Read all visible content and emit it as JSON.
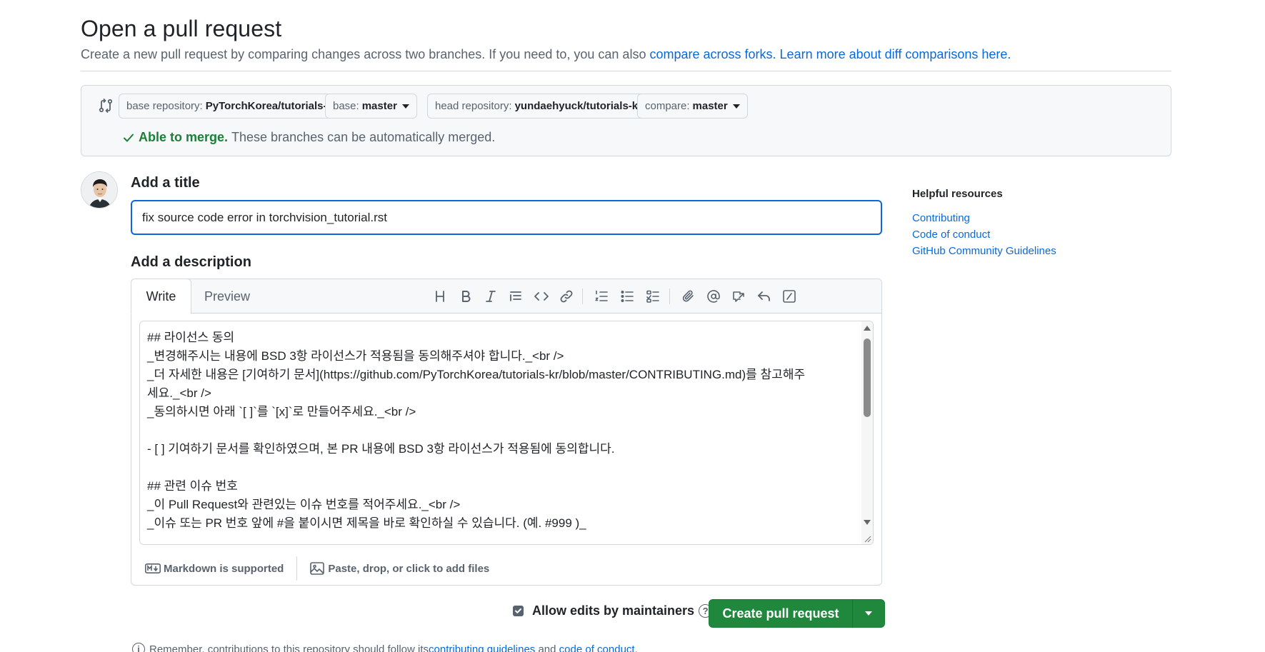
{
  "header": {
    "title": "Open a pull request",
    "subtitle_text": "Create a new pull request by comparing changes across two branches. If you need to, you can also ",
    "compare_forks_link": "compare across forks.",
    "learn_more_link": "Learn more about diff comparisons here."
  },
  "range": {
    "base_repo_label": "base repository:",
    "base_repo_value": "PyTorchKorea/tutorials-kr",
    "base_label": "base:",
    "base_value": "master",
    "head_repo_label": "head repository:",
    "head_repo_value": "yundaehyuck/tutorials-kr",
    "compare_label": "compare:",
    "compare_value": "master",
    "merge_ok": "Able to merge.",
    "merge_text": "These branches can be automatically merged."
  },
  "form": {
    "title_label": "Add a title",
    "title_value": "fix source code error in torchvision_tutorial.rst",
    "description_label": "Add a description",
    "tab_write": "Write",
    "tab_preview": "Preview",
    "description_lines": [
      "## 라이선스 동의",
      "_변경해주시는 내용에 BSD 3항 라이선스가 적용됨을 동의해주셔야 합니다._<br />",
      "_더 자세한 내용은 [기여하기 문서](https://github.com/PyTorchKorea/tutorials-kr/blob/master/CONTRIBUTING.md)를 참고해주",
      "세요._<br />",
      "_동의하시면 아래 `[ ]`를 `[x]`로 만들어주세요._<br />",
      "",
      "- [ ] 기여하기 문서를 확인하였으며, 본 PR 내용에 BSD 3항 라이선스가 적용됨에 동의합니다.",
      "",
      "## 관련 이슈 번호",
      "_이 Pull Request와 관련있는 이슈 번호를 적어주세요._<br />",
      "_이슈 또는 PR 번호 앞에 #을 붙이시면 제목을 바로 확인하실 수 있습니다. (예. #999 )_"
    ],
    "markdown_supported": "Markdown is supported",
    "attach_files": "Paste, drop, or click to add files",
    "allow_edits": "Allow edits by maintainers",
    "allow_edits_checked": true,
    "create_button": "Create pull request"
  },
  "footer": {
    "remember_text": "Remember, contributions to this repository should follow its ",
    "contributing_link": "contributing guidelines",
    "and_text": " and ",
    "conduct_link": "code of conduct",
    "period": "."
  },
  "sidebar": {
    "heading": "Helpful resources",
    "links": [
      "Contributing",
      "Code of conduct",
      "GitHub Community Guidelines"
    ]
  },
  "colors": {
    "accent": "#0969da",
    "success": "#1a7f37",
    "button_green": "#1f883d",
    "muted": "#59636e"
  }
}
